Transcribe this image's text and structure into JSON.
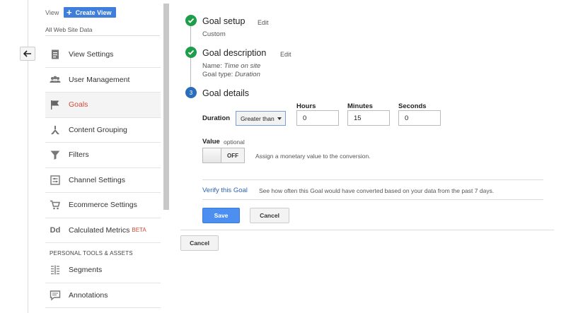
{
  "admin": {
    "view_label": "View",
    "create_view_label": "Create View",
    "view_name": "All Web Site Data",
    "nav_items": [
      {
        "label": "View Settings",
        "icon": "document-icon"
      },
      {
        "label": "User Management",
        "icon": "users-icon"
      },
      {
        "label": "Goals",
        "icon": "flag-icon",
        "active": true
      },
      {
        "label": "Content Grouping",
        "icon": "content-grouping-icon"
      },
      {
        "label": "Filters",
        "icon": "filter-icon"
      },
      {
        "label": "Channel Settings",
        "icon": "channel-settings-icon"
      },
      {
        "label": "Ecommerce Settings",
        "icon": "cart-icon"
      },
      {
        "label": "Calculated Metrics",
        "icon": "calculated-metrics-icon",
        "badge": "BETA",
        "icon_text": "Dd"
      }
    ],
    "section_header": "PERSONAL TOOLS & ASSETS",
    "personal_items": [
      {
        "label": "Segments",
        "icon": "segments-icon"
      },
      {
        "label": "Annotations",
        "icon": "annotations-icon"
      }
    ]
  },
  "steps": {
    "setup": {
      "title": "Goal setup",
      "edit": "Edit",
      "summary": "Custom"
    },
    "description": {
      "title": "Goal description",
      "edit": "Edit",
      "name_label": "Name:",
      "name_value": "Time on site",
      "type_label": "Goal type:",
      "type_value": "Duration"
    },
    "details": {
      "number": "3",
      "title": "Goal details",
      "duration_label": "Duration",
      "comparison": "Greater than",
      "hours_label": "Hours",
      "hours_value": "0",
      "minutes_label": "Minutes",
      "minutes_value": "15",
      "seconds_label": "Seconds",
      "seconds_value": "0",
      "value_label": "Value",
      "value_optional": "optional",
      "toggle_state": "OFF",
      "value_help": "Assign a monetary value to the conversion.",
      "verify_link": "Verify this Goal",
      "verify_desc": "See how often this Goal would have converted based on your data from the past 7 days.",
      "save_label": "Save",
      "cancel_label": "Cancel"
    }
  },
  "footer": {
    "cancel_label": "Cancel"
  },
  "colors": {
    "accent": "#4d8ff0",
    "active_nav": "#d14836",
    "done": "#1e9e4a",
    "current_step": "#2a6ebb"
  }
}
